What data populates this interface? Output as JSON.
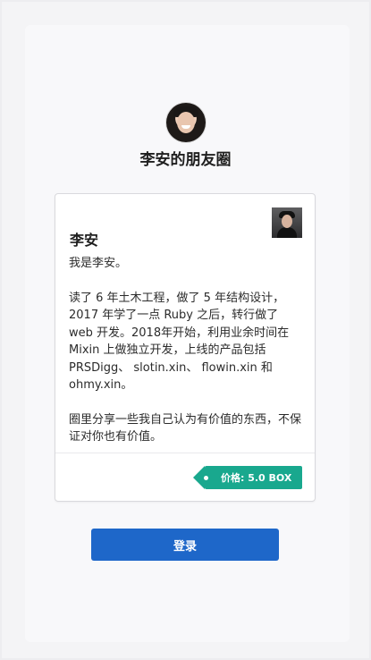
{
  "header": {
    "title": "李安的朋友圈",
    "avatar_icon": "profile-avatar"
  },
  "card": {
    "name": "李安",
    "avatar_icon": "profile-photo",
    "paragraphs": [
      "我是李安。",
      "读了 6 年土木工程，做了 5 年结构设计，2017 年学了一点 Ruby 之后，转行做了 web 开发。2018年开始，利用业余时间在 Mixin 上做独立开发，上线的产品包括 PRSDigg、 slotin.xin、 flowin.xin 和 ohmy.xin。",
      "圈里分享一些我自己认为有价值的东西，不保证对你也有价值。"
    ],
    "price_label": "价格: 5.0 BOX",
    "price_color": "#19a88e"
  },
  "actions": {
    "login_label": "登录",
    "login_color": "#1e67c9"
  }
}
